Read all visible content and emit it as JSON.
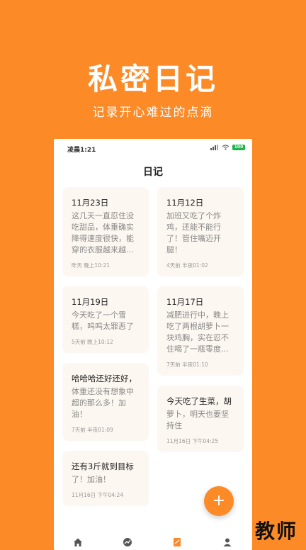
{
  "promo": {
    "title": "私密日记",
    "subtitle": "记录开心难过的点滴"
  },
  "status_bar": {
    "time": "凌晨1:21",
    "battery": "100"
  },
  "header": {
    "title": "日记"
  },
  "cards": [
    {
      "title": "11月23日",
      "body": "这几天一直忍住没吃甜品，体重确实降得速度很快，能穿的衣服越来越...",
      "time": "昨天  晚上10:21"
    },
    {
      "title": "11月12日",
      "body": "加班又吃了个炸鸡，还能不能行了！管住嘴迈开腿！",
      "time": "4天前  半夜01:02"
    },
    {
      "title": "11月19日",
      "body": "今天吃了一个雪糕，呜呜太罪恶了",
      "time": "5天前  晚上10:12"
    },
    {
      "title": "11月17日",
      "body": "减肥进行中，晚上吃了两根胡萝卜一块鸡胸，实在忍不住喝了一瓶零度...",
      "time": "7天前  半夜01:10"
    },
    {
      "title": "哈哈哈还好还好，",
      "body": "体重还没有想象中超的那么多！加油！",
      "time": "7天前  半夜01:09"
    },
    {
      "title": "今天吃了生菜，胡",
      "body": "萝卜，明天也要坚持住",
      "time": "11月16日  下午04:25"
    },
    {
      "title": "还有3斤就到目标",
      "body": "了！加油！",
      "time": "11月16日  下午04:24"
    }
  ],
  "fab": {
    "label": "+"
  },
  "nav": {
    "icons": [
      "home-icon",
      "chart-icon",
      "diary-icon",
      "profile-icon"
    ]
  },
  "watermark": "教师"
}
